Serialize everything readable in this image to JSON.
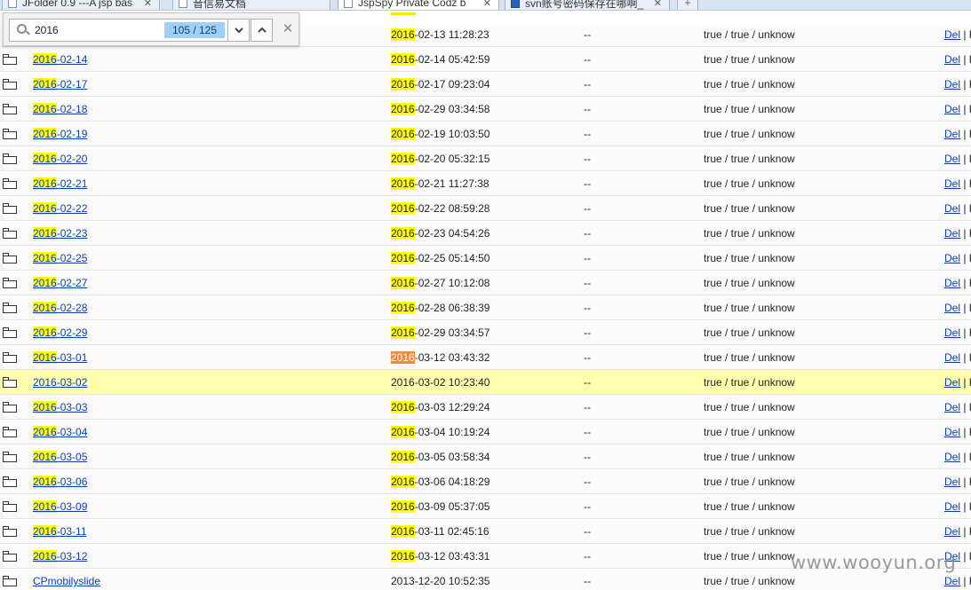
{
  "tabs": [
    {
      "title": "JFolder 0.9 ---A jsp bas",
      "active": false,
      "icon": "page-icon"
    },
    {
      "title": "音信易文档",
      "active": false,
      "icon": "page-icon"
    },
    {
      "title": "JspSpy Private Codz b",
      "active": true,
      "icon": "page-icon"
    },
    {
      "title": "svn账号密码保存在哪啊_",
      "active": false,
      "icon": "paw-icon"
    }
  ],
  "find": {
    "query": "2016",
    "count": "105 / 125"
  },
  "highlight_term": "2016",
  "top_row": {
    "time": "2016-02-13 11:28:23",
    "size": "--",
    "perm": "true / true / unknow",
    "act": "Del | F"
  },
  "rows": [
    {
      "name": "2016-02-14",
      "time": "2016-02-14 05:42:59",
      "size": "--",
      "perm": "true / true / unknow",
      "del": "Del",
      "sep": "| F"
    },
    {
      "name": "2016-02-17",
      "time": "2016-02-17 09:23:04",
      "size": "--",
      "perm": "true / true / unknow",
      "del": "Del",
      "sep": "| F"
    },
    {
      "name": "2016-02-18",
      "time": "2016-02-29 03:34:58",
      "size": "--",
      "perm": "true / true / unknow",
      "del": "Del",
      "sep": "| F"
    },
    {
      "name": "2016-02-19",
      "time": "2016-02-19 10:03:50",
      "size": "--",
      "perm": "true / true / unknow",
      "del": "Del",
      "sep": "| F"
    },
    {
      "name": "2016-02-20",
      "time": "2016-02-20 05:32:15",
      "size": "--",
      "perm": "true / true / unknow",
      "del": "Del",
      "sep": "| F"
    },
    {
      "name": "2016-02-21",
      "time": "2016-02-21 11:27:38",
      "size": "--",
      "perm": "true / true / unknow",
      "del": "Del",
      "sep": "| F"
    },
    {
      "name": "2016-02-22",
      "time": "2016-02-22 08:59:28",
      "size": "--",
      "perm": "true / true / unknow",
      "del": "Del",
      "sep": "| F"
    },
    {
      "name": "2016-02-23",
      "time": "2016-02-23 04:54:26",
      "size": "--",
      "perm": "true / true / unknow",
      "del": "Del",
      "sep": "| F"
    },
    {
      "name": "2016-02-25",
      "time": "2016-02-25 05:14:50",
      "size": "--",
      "perm": "true / true / unknow",
      "del": "Del",
      "sep": "| F"
    },
    {
      "name": "2016-02-27",
      "time": "2016-02-27 10:12:08",
      "size": "--",
      "perm": "true / true / unknow",
      "del": "Del",
      "sep": "| F"
    },
    {
      "name": "2016-02-28",
      "time": "2016-02-28 06:38:39",
      "size": "--",
      "perm": "true / true / unknow",
      "del": "Del",
      "sep": "| F"
    },
    {
      "name": "2016-02-29",
      "time": "2016-02-29 03:34:57",
      "size": "--",
      "perm": "true / true / unknow",
      "del": "Del",
      "sep": "| F"
    },
    {
      "name": "2016-03-01",
      "time": "2016-03-12 03:43:32",
      "size": "--",
      "perm": "true / true / unknow",
      "del": "Del",
      "sep": "| F",
      "current_match": "time"
    },
    {
      "name": "2016-03-02",
      "time": "2016-03-02 10:23:40",
      "size": "--",
      "perm": "true / true / unknow",
      "del": "Del",
      "sep": "| F",
      "hovered": true,
      "no_highlight": true
    },
    {
      "name": "2016-03-03",
      "time": "2016-03-03 12:29:24",
      "size": "--",
      "perm": "true / true / unknow",
      "del": "Del",
      "sep": "| F"
    },
    {
      "name": "2016-03-04",
      "time": "2016-03-04 10:19:24",
      "size": "--",
      "perm": "true / true / unknow",
      "del": "Del",
      "sep": "| F"
    },
    {
      "name": "2016-03-05",
      "time": "2016-03-05 03:58:34",
      "size": "--",
      "perm": "true / true / unknow",
      "del": "Del",
      "sep": "| F"
    },
    {
      "name": "2016-03-06",
      "time": "2016-03-06 04:18:29",
      "size": "--",
      "perm": "true / true / unknow",
      "del": "Del",
      "sep": "| F"
    },
    {
      "name": "2016-03-09",
      "time": "2016-03-09 05:37:05",
      "size": "--",
      "perm": "true / true / unknow",
      "del": "Del",
      "sep": "| F"
    },
    {
      "name": "2016-03-11",
      "time": "2016-03-11 02:45:16",
      "size": "--",
      "perm": "true / true / unknow",
      "del": "Del",
      "sep": "| F"
    },
    {
      "name": "2016-03-12",
      "time": "2016-03-12 03:43:31",
      "size": "--",
      "perm": "true / true / unknow",
      "del": "Del",
      "sep": "| F"
    },
    {
      "name": "CPmobilyslide",
      "time": "2013-12-20 10:52:35",
      "size": "--",
      "perm": "true / true / unknow",
      "del": "Del",
      "sep": "| F"
    }
  ],
  "colors": {
    "match_highlight": "#ffff00",
    "current_match": "#f08a3c",
    "hover_row": "#ffffb0",
    "link": "#0b3fb4",
    "find_count_bg": "#9fd0f7"
  },
  "watermark": "www.wooyun.org"
}
